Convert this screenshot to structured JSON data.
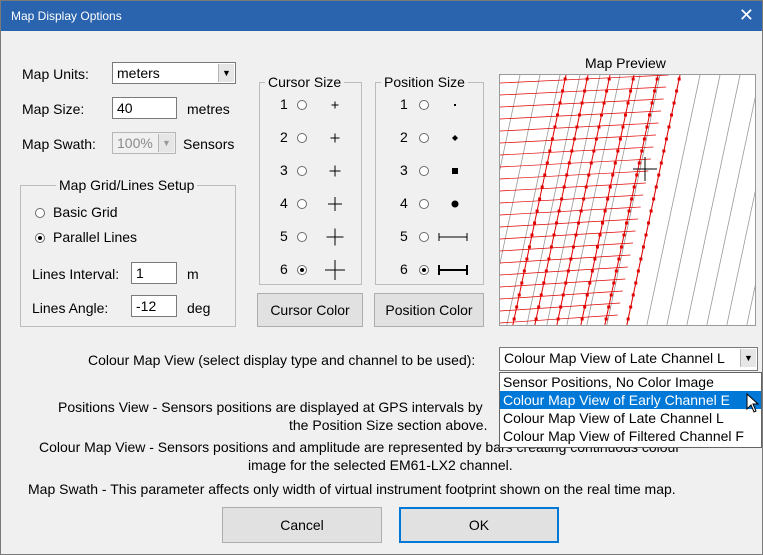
{
  "window": {
    "title": "Map Display Options",
    "close_glyph": "✕"
  },
  "map_units": {
    "label": "Map Units:",
    "value": "meters"
  },
  "map_size": {
    "label": "Map Size:",
    "value": "40",
    "unit": "metres"
  },
  "map_swath": {
    "label": "Map Swath:",
    "value": "100%",
    "unit": "Sensors",
    "enabled": false
  },
  "grid_setup": {
    "title": "Map Grid/Lines Setup",
    "basic_grid": {
      "label": "Basic Grid",
      "selected": false
    },
    "parallel_lines": {
      "label": "Parallel Lines",
      "selected": true
    },
    "lines_interval": {
      "label": "Lines Interval:",
      "value": "1",
      "unit": "m"
    },
    "lines_angle": {
      "label": "Lines Angle:",
      "value": "-12",
      "unit": "deg"
    }
  },
  "cursor_size": {
    "title": "Cursor Size",
    "options": [
      {
        "num": "1",
        "glyph": "+",
        "selected": false
      },
      {
        "num": "2",
        "glyph": "+",
        "selected": false
      },
      {
        "num": "3",
        "glyph": "+",
        "selected": false
      },
      {
        "num": "4",
        "glyph": "+",
        "selected": false
      },
      {
        "num": "5",
        "glyph": "+",
        "selected": false
      },
      {
        "num": "6",
        "glyph": "+",
        "selected": true
      }
    ]
  },
  "position_size": {
    "title": "Position Size",
    "options": [
      {
        "num": "1",
        "selected": false
      },
      {
        "num": "2",
        "selected": false
      },
      {
        "num": "3",
        "selected": false
      },
      {
        "num": "4",
        "selected": false
      },
      {
        "num": "5",
        "selected": false
      },
      {
        "num": "6",
        "selected": true
      }
    ]
  },
  "buttons": {
    "cursor_color": "Cursor Color",
    "position_color": "Position Color",
    "cancel": "Cancel",
    "ok": "OK"
  },
  "preview": {
    "title": "Map Preview",
    "line_color": "#e00000",
    "angle_deg": -12
  },
  "colour_map_view": {
    "label": "Colour Map View (select display type and channel to be used):",
    "value": "Colour Map View of Late Channel L",
    "options": [
      {
        "label": "Sensor Positions, No Color Image",
        "highlighted": false
      },
      {
        "label": "Colour Map View of Early Channel E",
        "highlighted": true
      },
      {
        "label": "Colour Map View of Late Channel L",
        "highlighted": false
      },
      {
        "label": "Colour Map View of Filtered Channel F",
        "highlighted": false
      }
    ]
  },
  "info": {
    "positions_line1": "Positions View - Sensors positions are displayed at GPS intervals by",
    "positions_line2": "the Position Size section above.",
    "colour_line1": "Colour Map View - Sensors positions and amplitude are represented by bars creating continuous colour",
    "colour_line2": "image for the selected EM61-LX2 channel.",
    "swath_line": "Map Swath - This parameter affects only width of virtual instrument footprint shown on the real time map."
  }
}
